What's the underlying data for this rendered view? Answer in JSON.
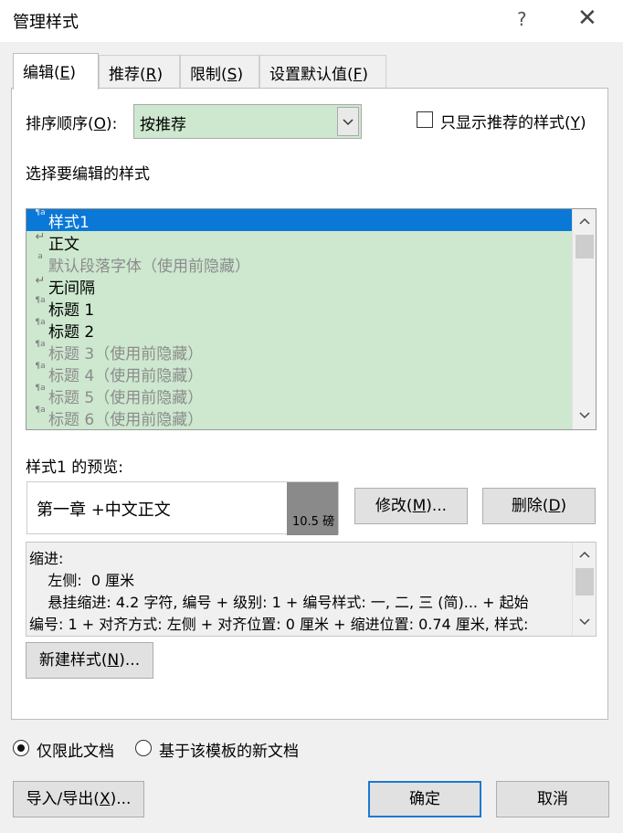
{
  "window": {
    "title": "管理样式",
    "help_glyph": "?",
    "close_glyph": "✕"
  },
  "tabs": [
    {
      "label_pre": "编辑(",
      "key": "E",
      "label_post": ")",
      "active": true
    },
    {
      "label_pre": "推荐(",
      "key": "R",
      "label_post": ")",
      "active": false
    },
    {
      "label_pre": "限制(",
      "key": "S",
      "label_post": ")",
      "active": false
    },
    {
      "label_pre": "设置默认值(",
      "key": "F",
      "label_post": ")",
      "active": false
    }
  ],
  "sort": {
    "label_pre": "排序顺序(",
    "key": "O",
    "label_post": "):",
    "value": "按推荐"
  },
  "only_recommended": {
    "label_pre": "只显示推荐的样式(",
    "key": "Y",
    "label_post": ")",
    "checked": false
  },
  "list_heading": "选择要编辑的样式",
  "styles": [
    {
      "icon": "¶a",
      "name": "样式1",
      "selected": true,
      "hidden": false
    },
    {
      "icon": "↵",
      "name": "正文",
      "selected": false,
      "hidden": false
    },
    {
      "icon": "a",
      "name": "默认段落字体（使用前隐藏）",
      "selected": false,
      "hidden": true
    },
    {
      "icon": "↵",
      "name": "无间隔",
      "selected": false,
      "hidden": false
    },
    {
      "icon": "¶a",
      "name": "标题 1",
      "selected": false,
      "hidden": false
    },
    {
      "icon": "¶a",
      "name": "标题 2",
      "selected": false,
      "hidden": false
    },
    {
      "icon": "¶a",
      "name": "标题 3（使用前隐藏）",
      "selected": false,
      "hidden": true
    },
    {
      "icon": "¶a",
      "name": "标题 4（使用前隐藏）",
      "selected": false,
      "hidden": true
    },
    {
      "icon": "¶a",
      "name": "标题 5（使用前隐藏）",
      "selected": false,
      "hidden": true
    },
    {
      "icon": "¶a",
      "name": "标题 6（使用前隐藏）",
      "selected": false,
      "hidden": true
    }
  ],
  "preview": {
    "heading": "样式1 的预览:",
    "sample": "第一章 +中文正文",
    "size": "10.5 磅"
  },
  "buttons": {
    "modify_pre": "修改(",
    "modify_key": "M",
    "modify_post": ")...",
    "delete_pre": "删除(",
    "delete_key": "D",
    "delete_post": ")",
    "new_pre": "新建样式(",
    "new_key": "N",
    "new_post": ")...",
    "import_pre": "导入/导出(",
    "import_key": "X",
    "import_post": ")...",
    "ok": "确定",
    "cancel": "取消"
  },
  "description": [
    "缩进:",
    "    左侧:  0 厘米",
    "    悬挂缩进: 4.2 字符, 编号 + 级别: 1 + 编号样式: 一, 二, 三 (简)... + 起始",
    "编号: 1 + 对齐方式: 左侧 + 对齐位置:  0 厘米 + 缩进位置:  0.74 厘米, 样式:"
  ],
  "scope": {
    "option1": "仅限此文档",
    "option2": "基于该模板的新文档",
    "selected": "option1"
  },
  "colors": {
    "list_bg": "#cde8cf",
    "selection": "#0a78d7",
    "default_button_border": "#1e78d0"
  }
}
